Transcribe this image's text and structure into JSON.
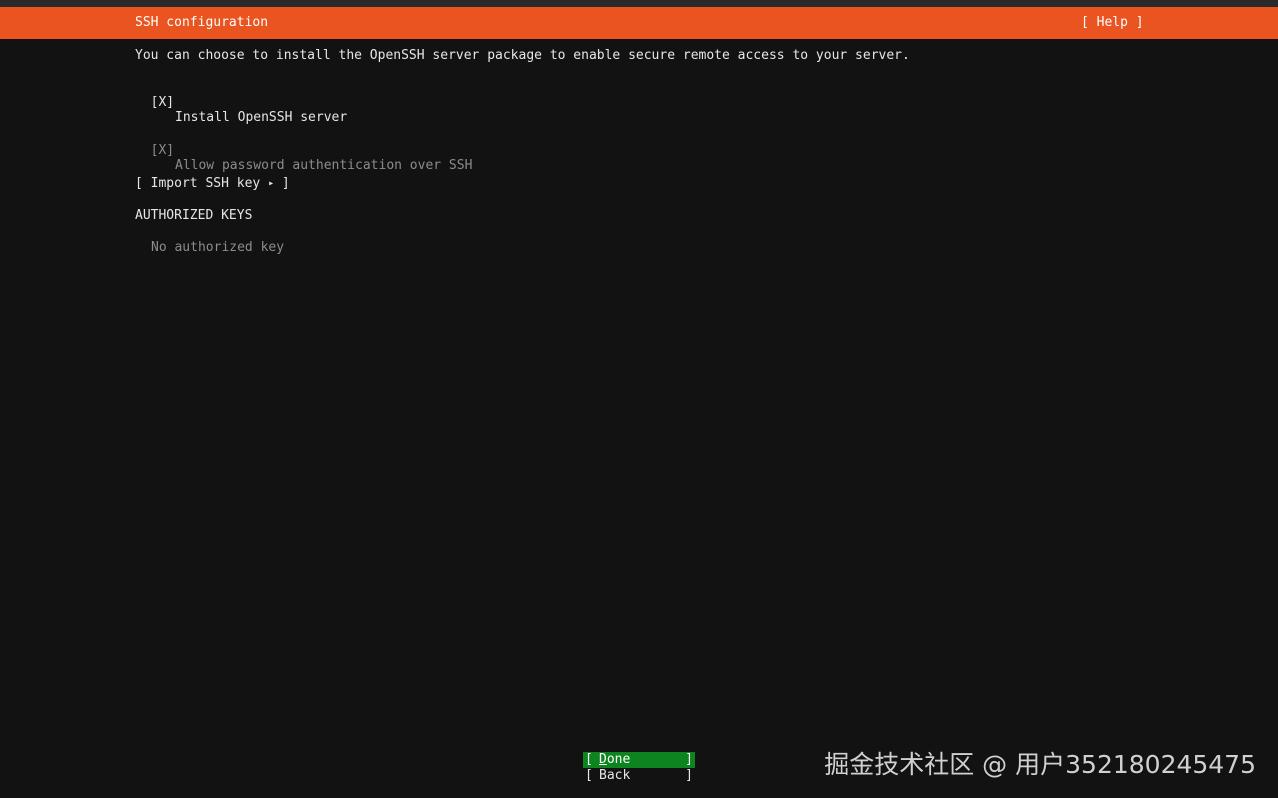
{
  "header": {
    "title": "SSH configuration",
    "help": "[ Help ]"
  },
  "intro": "You can choose to install the OpenSSH server package to enable secure remote access to your server.",
  "options": {
    "install_checkbox": "[X]",
    "install_label": "Install OpenSSH server",
    "password_checkbox": "[X]",
    "password_label": "Allow password authentication over SSH"
  },
  "import": {
    "open": "[ Import SSH key",
    "arrow": "▸",
    "close": "]"
  },
  "authorized": {
    "heading": "AUTHORIZED KEYS",
    "empty": "No authorized key"
  },
  "buttons": {
    "done_left": "[",
    "done_first": "D",
    "done_rest": "one",
    "done_right": "]",
    "back_left": "[",
    "back_label": "Back",
    "back_right": "]"
  },
  "watermark": "掘金技术社区 @ 用户352180245475",
  "colors": {
    "accent": "#e95420",
    "focus": "#0e8420",
    "background": "#121212"
  }
}
